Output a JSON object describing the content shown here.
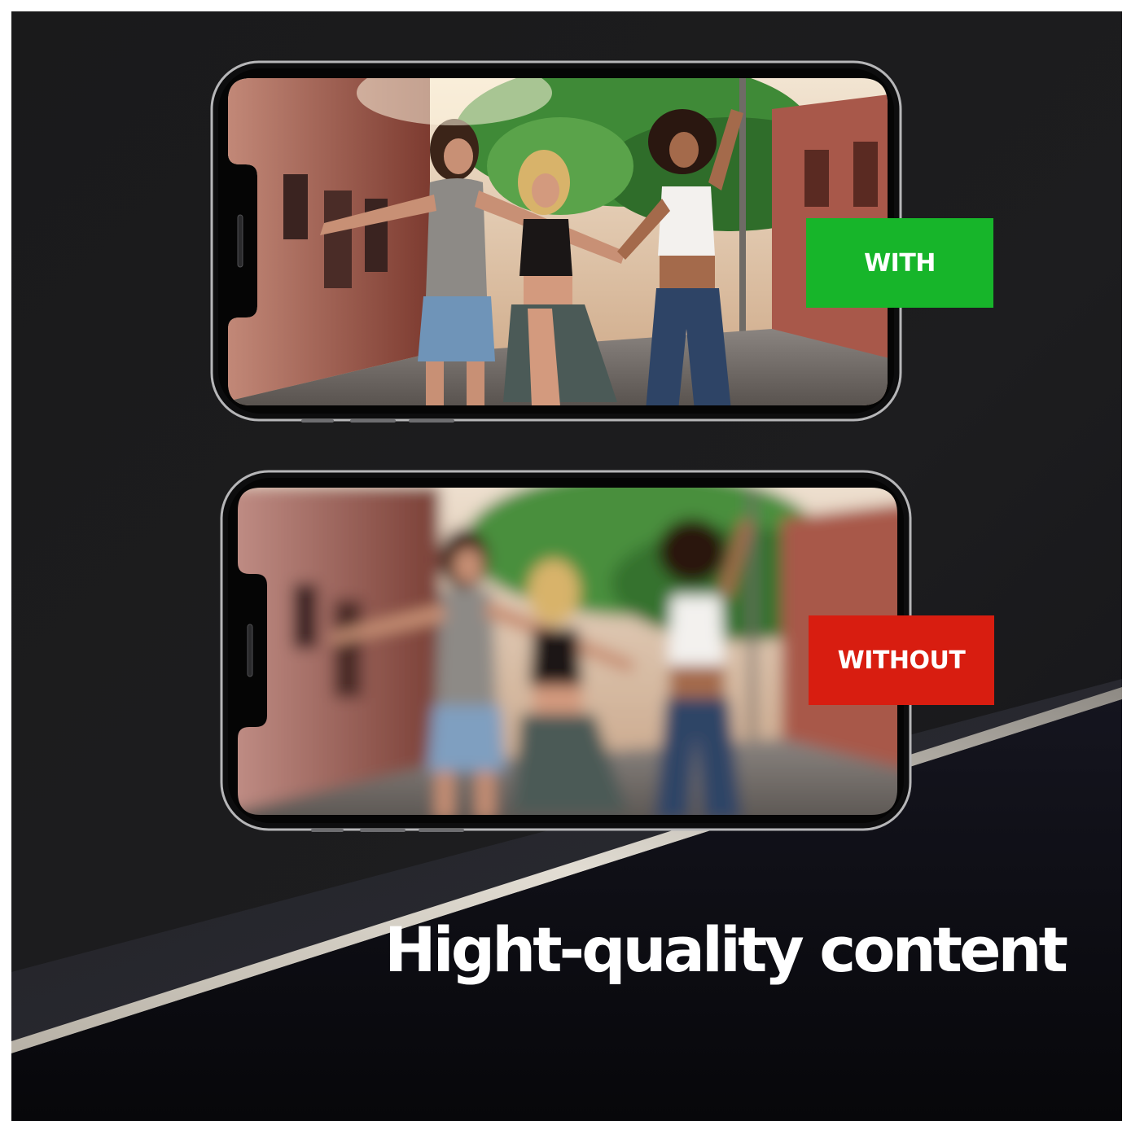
{
  "badges": {
    "with_label": "WITH",
    "without_label": "WITHOUT"
  },
  "headline": "Hight-quality content",
  "colors": {
    "background": "#1b1b1c",
    "with_badge": "#17b52a",
    "without_badge": "#d81d10",
    "headline_text": "#ffffff",
    "diagonal_band": "#c9c3b8"
  },
  "photos": {
    "top": {
      "state": "sharp",
      "description_icon": "street-dancers-photo"
    },
    "bottom": {
      "state": "blurred",
      "description_icon": "street-dancers-photo"
    }
  }
}
